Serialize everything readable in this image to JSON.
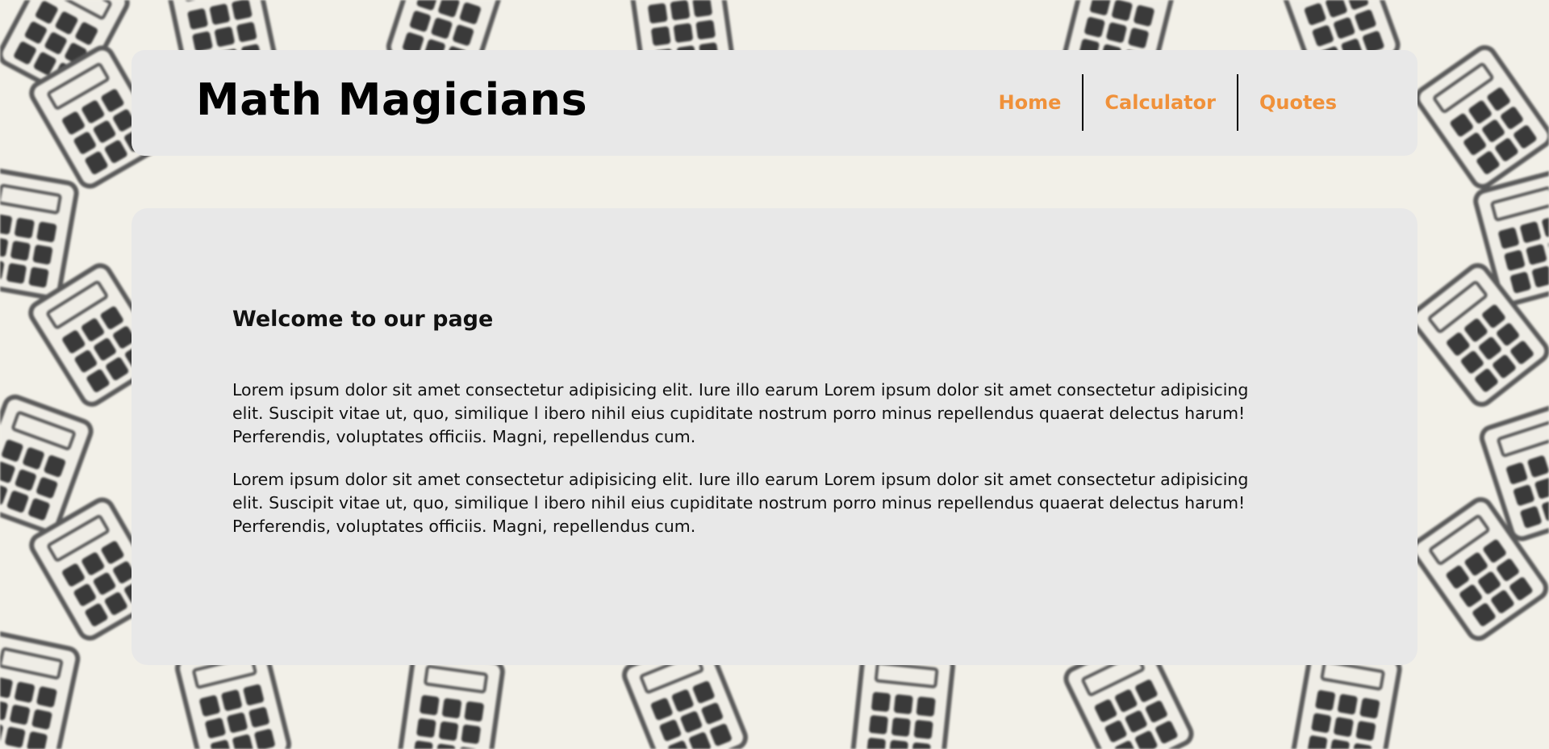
{
  "navbar": {
    "logo": "Math Magicians",
    "links": [
      {
        "label": "Home"
      },
      {
        "label": "Calculator"
      },
      {
        "label": "Quotes"
      }
    ]
  },
  "main": {
    "heading": "Welcome to our page",
    "paragraphs": [
      "Lorem ipsum dolor sit amet consectetur adipisicing elit. Iure illo earum Lorem ipsum dolor sit amet consectetur adipisicing elit. Suscipit vitae ut, quo, similique l ibero nihil eius cupiditate nostrum porro minus repellendus quaerat delectus harum! Perferendis, voluptates officiis. Magni, repellendus cum.",
      "Lorem ipsum dolor sit amet consectetur adipisicing elit. Iure illo earum Lorem ipsum dolor sit amet consectetur adipisicing elit. Suscipit vitae ut, quo, similique l ibero nihil eius cupiditate nostrum porro minus repellendus quaerat delectus harum! Perferendis, voluptates officiis. Magni, repellendus cum."
    ]
  },
  "background": {
    "pattern": "calculator-icon",
    "color": "#f2f0e8"
  },
  "colors": {
    "accent": "#f0913a",
    "panel": "#e8e8e8"
  }
}
